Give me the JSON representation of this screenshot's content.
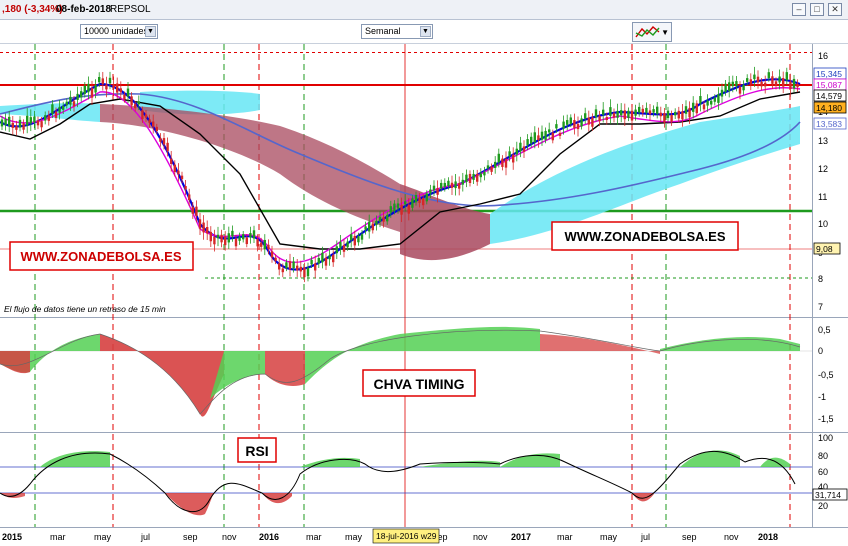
{
  "window": {
    "change_text": ",180 (-3,34%)",
    "date_text": "08-feb-2018",
    "symbol_text": "REPSOL"
  },
  "toolbar": {
    "units_value": "10000 unidades",
    "period_value": "Semanal"
  },
  "price_panel": {
    "y_ticks": [
      "16",
      "15",
      "14",
      "13",
      "12",
      "11",
      "10",
      "9",
      "8",
      "7"
    ],
    "price_tags": [
      {
        "text": "15,345",
        "color": "#1f3fbf"
      },
      {
        "text": "15,087",
        "color": "#cc00cc"
      },
      {
        "text": "14,579",
        "color": "#000000"
      },
      {
        "text": "14,180",
        "color": "#000000"
      },
      {
        "text": "13,583",
        "color": "#5566cc"
      },
      {
        "text": "9,08",
        "color": "#000000"
      }
    ],
    "watermark_left": "WWW.ZONADEBOLSA.ES",
    "watermark_right": "WWW.ZONADEBOLSA.ES",
    "data_notice": "El flujo de datos tiene un retraso de 15 min"
  },
  "chva_panel": {
    "title": "CHVA TIMING",
    "y_ticks": [
      "0,5",
      "0",
      "-0,5",
      "-1",
      "-1,5"
    ]
  },
  "rsi_panel": {
    "title": "RSI",
    "y_ticks": [
      "100",
      "80",
      "60",
      "40",
      "20"
    ],
    "value_tag": "31,714"
  },
  "time_axis": {
    "labels": [
      "2015",
      "mar",
      "may",
      "jul",
      "sep",
      "nov",
      "2016",
      "mar",
      "may",
      "jul",
      "sep",
      "nov",
      "2017",
      "mar",
      "may",
      "jul",
      "sep",
      "nov",
      "2018"
    ],
    "cursor_label": "18-jul-2016 w29"
  },
  "colors": {
    "accent_red": "#e00000",
    "support_green": "#1e9a1e",
    "kumo_bull": "#66e6f5",
    "kumo_bear": "#a8485e",
    "ma_blue": "#0000dd",
    "ma_magenta": "#dd00dd"
  }
}
